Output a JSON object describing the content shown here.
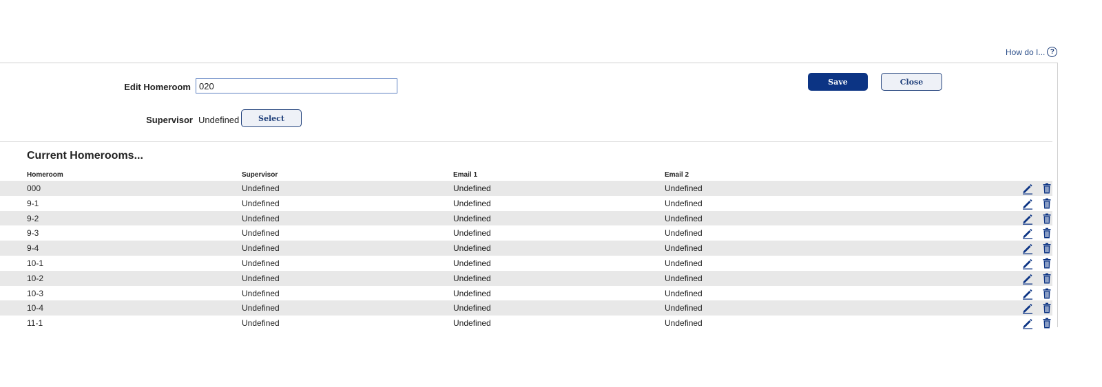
{
  "help": {
    "label": "How do I...",
    "icon": "help-icon"
  },
  "form": {
    "edit_label": "Edit Homeroom",
    "homeroom_value": "020",
    "supervisor_label": "Supervisor",
    "supervisor_value": "Undefined",
    "select_label": "Select",
    "save_label": "Save",
    "close_label": "Close"
  },
  "section_title": "Current Homerooms...",
  "table": {
    "headers": [
      "Homeroom",
      "Supervisor",
      "Email 1",
      "Email 2"
    ],
    "rows": [
      [
        "000",
        "Undefined",
        "Undefined",
        "Undefined"
      ],
      [
        "9-1",
        "Undefined",
        "Undefined",
        "Undefined"
      ],
      [
        "9-2",
        "Undefined",
        "Undefined",
        "Undefined"
      ],
      [
        "9-3",
        "Undefined",
        "Undefined",
        "Undefined"
      ],
      [
        "9-4",
        "Undefined",
        "Undefined",
        "Undefined"
      ],
      [
        "10-1",
        "Undefined",
        "Undefined",
        "Undefined"
      ],
      [
        "10-2",
        "Undefined",
        "Undefined",
        "Undefined"
      ],
      [
        "10-3",
        "Undefined",
        "Undefined",
        "Undefined"
      ],
      [
        "10-4",
        "Undefined",
        "Undefined",
        "Undefined"
      ],
      [
        "11-1",
        "Undefined",
        "Undefined",
        "Undefined"
      ]
    ],
    "row_icons": [
      "edit-pencil-icon",
      "delete-trash-icon"
    ]
  },
  "colors": {
    "primary": "#0c3484",
    "icon": "#0c3484",
    "alt_row": "#e8e8e8",
    "link": "#2c4f8a"
  }
}
